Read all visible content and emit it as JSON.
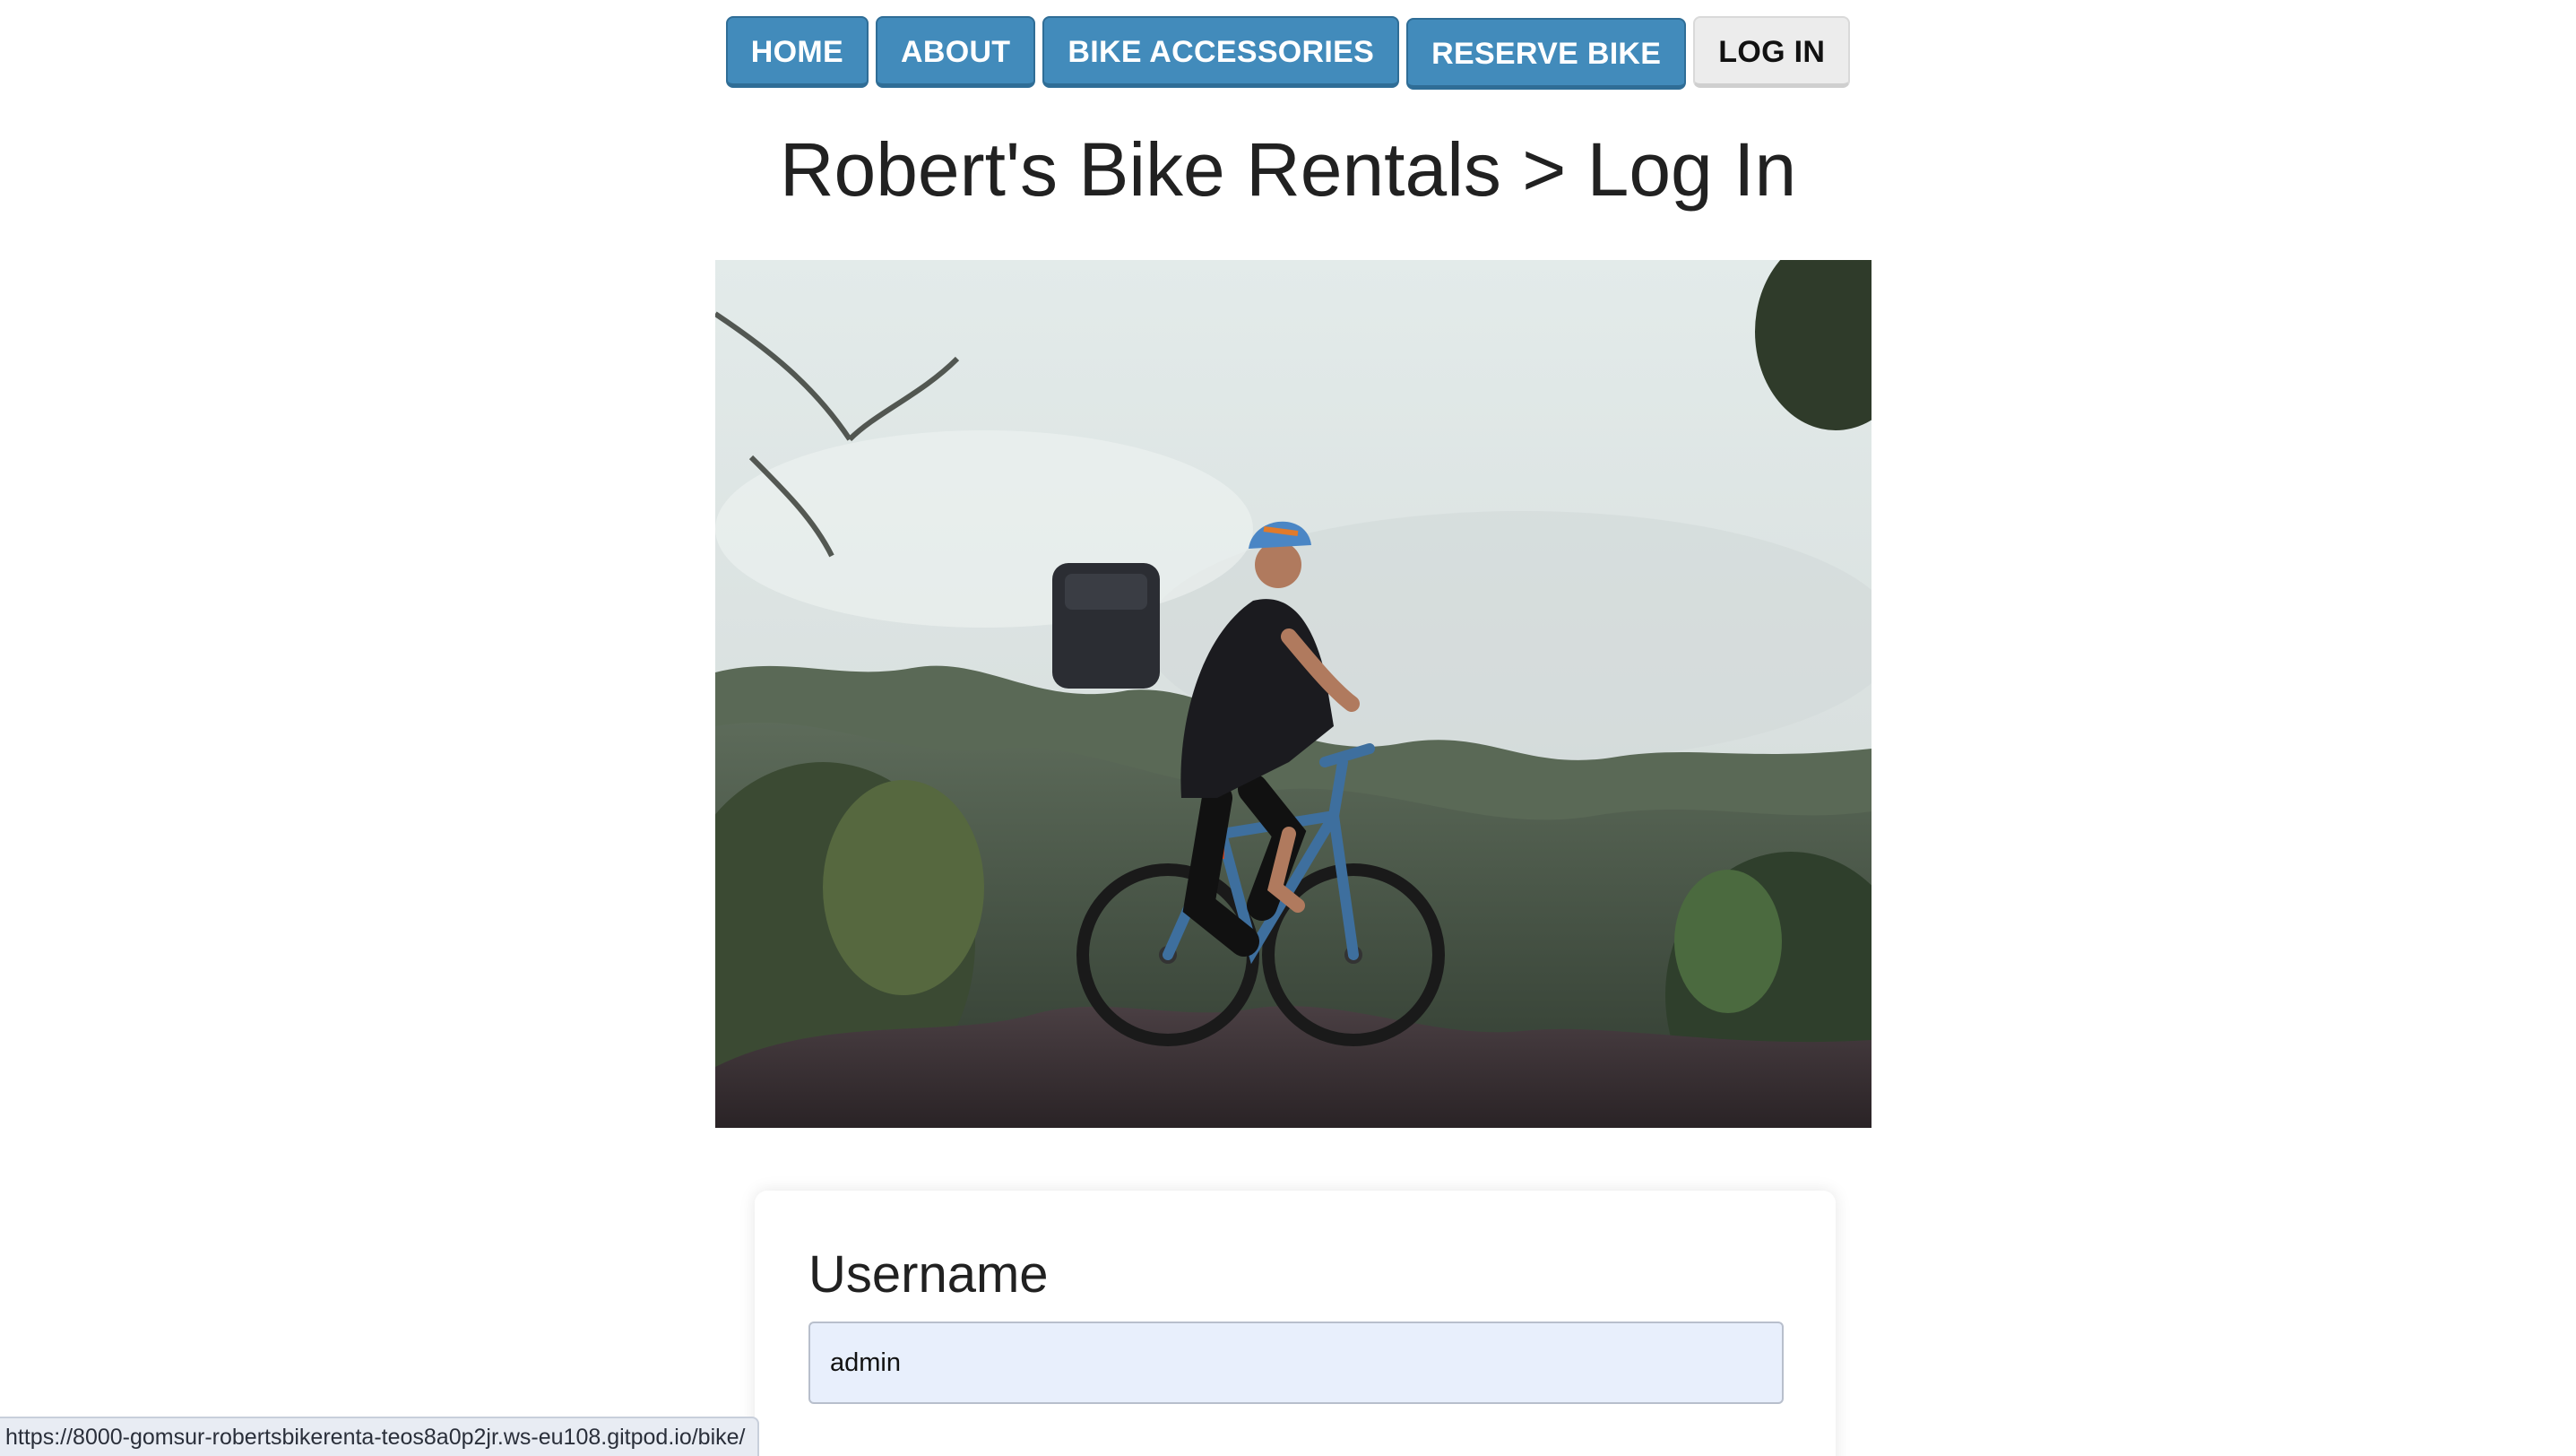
{
  "nav": {
    "items": [
      {
        "label": "HOME"
      },
      {
        "label": "ABOUT"
      },
      {
        "label": "BIKE ACCESSORIES"
      },
      {
        "label": "RESERVE BIKE"
      },
      {
        "label": "LOG IN"
      }
    ]
  },
  "page": {
    "title": "Robert's Bike Rentals > Log In"
  },
  "hero": {
    "icon": "mountain-biker-photo"
  },
  "form": {
    "username_label": "Username",
    "username_value": "admin"
  },
  "status": {
    "url": "https://8000-gomsur-robertsbikerenta-teos8a0p2jr.ws-eu108.gitpod.io/bike/"
  },
  "colors": {
    "nav_button": "#428bbb",
    "nav_active": "#ececec",
    "input_background": "#e8effc"
  }
}
